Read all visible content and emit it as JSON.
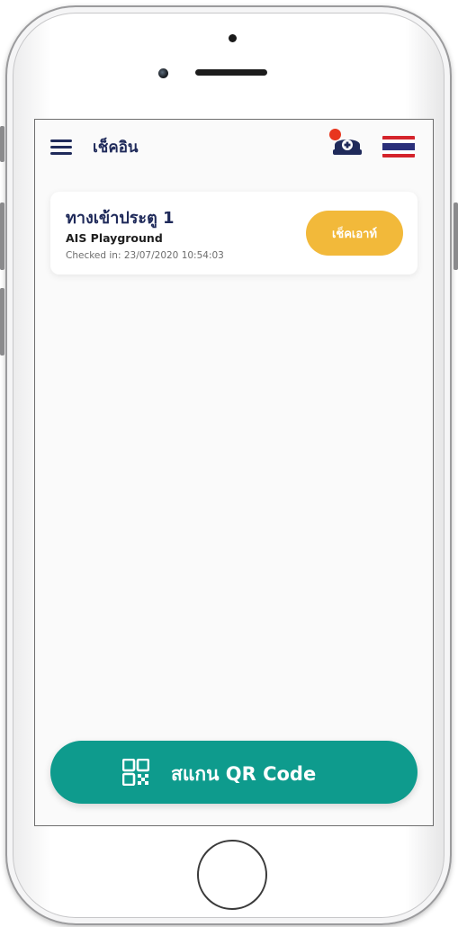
{
  "header": {
    "title": "เช็คอิน",
    "menu_icon": "hamburger-menu-icon",
    "nurse_icon": "nurse-cap-icon",
    "notification_color": "#e8361e",
    "language_flag": "thailand-flag-icon"
  },
  "checkin_card": {
    "title": "ทางเข้าประตู 1",
    "place": "AIS Playground",
    "checked_in": "Checked in: 23/07/2020 10:54:03",
    "checkout_label": "เช็คเอาท์",
    "checkout_color": "#f2b93a"
  },
  "scan_button": {
    "label": "สแกน QR Code",
    "icon": "qr-code-icon",
    "color": "#0e9b8d"
  },
  "colors": {
    "primary_text": "#1f2a5a",
    "background": "#fafafa"
  }
}
